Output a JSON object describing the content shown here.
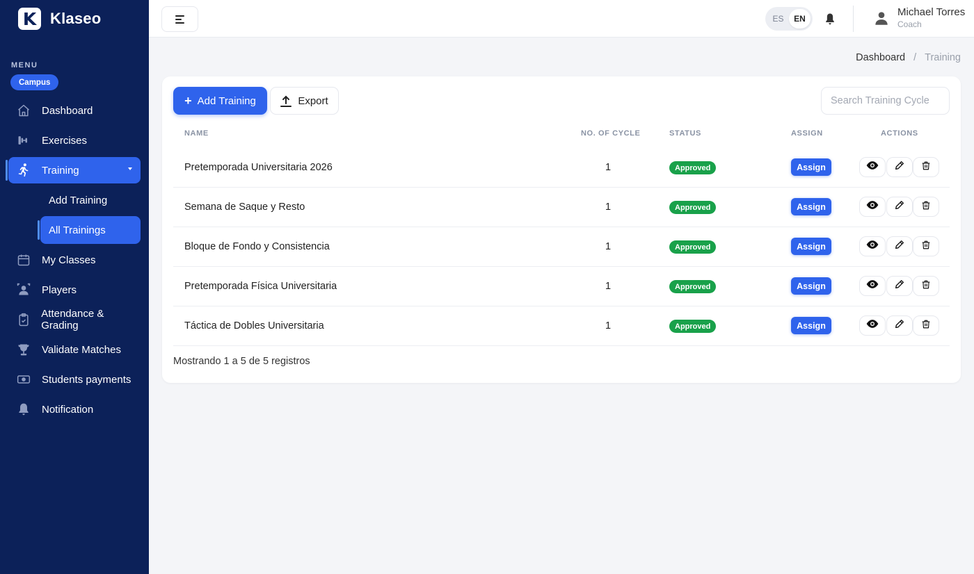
{
  "brand": {
    "logo_letter": "K",
    "name": "Klaseo"
  },
  "sidebar": {
    "menu_label": "MENU",
    "campus_label": "Campus",
    "items": [
      {
        "label": "Dashboard",
        "icon": "home-icon"
      },
      {
        "label": "Exercises",
        "icon": "dumbbell-icon"
      },
      {
        "label": "Training",
        "icon": "running-icon",
        "active": true,
        "expanded": true
      },
      {
        "label": "My Classes",
        "icon": "calendar-icon"
      },
      {
        "label": "Players",
        "icon": "players-icon"
      },
      {
        "label": "Attendance & Grading",
        "icon": "clipboard-check-icon"
      },
      {
        "label": "Validate Matches",
        "icon": "trophy-icon"
      },
      {
        "label": "Students payments",
        "icon": "cash-icon"
      },
      {
        "label": "Notification",
        "icon": "bell-icon"
      }
    ],
    "sub_items": [
      {
        "label": "Add Training"
      },
      {
        "label": "All Trainings",
        "active": true
      }
    ]
  },
  "topbar": {
    "lang_options": [
      "ES",
      "EN"
    ],
    "lang_selected": "EN",
    "user_name": "Michael Torres",
    "user_role": "Coach"
  },
  "breadcrumb": {
    "home": "Dashboard",
    "separator": "/",
    "current": "Training"
  },
  "toolbar": {
    "add_label": "Add Training",
    "export_label": "Export",
    "search_placeholder": "Search Training Cycle"
  },
  "table": {
    "headers": {
      "name": "NAME",
      "cycles": "NO. OF CYCLE",
      "status": "STATUS",
      "assign": "ASSIGN",
      "actions": "ACTIONS"
    },
    "rows": [
      {
        "name": "Pretemporada Universitaria 2026",
        "cycles": "1",
        "status": "Approved",
        "assign": "Assign"
      },
      {
        "name": "Semana de Saque y Resto",
        "cycles": "1",
        "status": "Approved",
        "assign": "Assign"
      },
      {
        "name": "Bloque de Fondo y Consistencia",
        "cycles": "1",
        "status": "Approved",
        "assign": "Assign"
      },
      {
        "name": "Pretemporada Física Universitaria",
        "cycles": "1",
        "status": "Approved",
        "assign": "Assign"
      },
      {
        "name": "Táctica de Dobles Universitaria",
        "cycles": "1",
        "status": "Approved",
        "assign": "Assign"
      }
    ],
    "footer": "Mostrando 1 a 5 de 5 registros"
  },
  "colors": {
    "sidebar": "#0c2159",
    "primary": "#2f63ec",
    "approved": "#19a14a"
  }
}
